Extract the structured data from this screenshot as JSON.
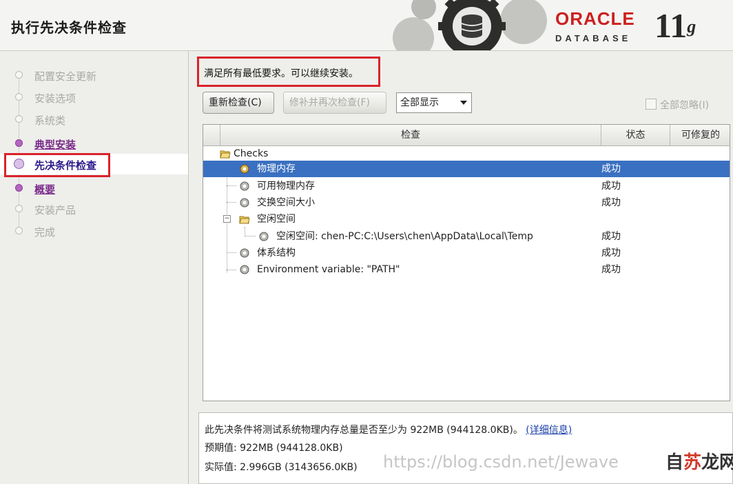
{
  "header": {
    "title": "执行先决条件检查",
    "brand_oracle": "ORACLE",
    "brand_database": "DATABASE",
    "brand_version": "11",
    "brand_version_sup": "g"
  },
  "sidebar": {
    "steps": [
      {
        "label": "配置安全更新",
        "state": "disabled"
      },
      {
        "label": "安装选项",
        "state": "disabled"
      },
      {
        "label": "系统类",
        "state": "disabled"
      },
      {
        "label": "典型安装",
        "state": "link"
      },
      {
        "label": "先决条件检查",
        "state": "active"
      },
      {
        "label": "概要",
        "state": "link"
      },
      {
        "label": "安装产品",
        "state": "disabled"
      },
      {
        "label": "完成",
        "state": "disabled"
      }
    ]
  },
  "main": {
    "message": "满足所有最低要求。可以继续安装。",
    "recheck_button": "重新检查(C)",
    "fix_button": "修补并再次检查(F)",
    "filter_select": "全部显示",
    "ignore_all_label": "全部忽略(I)",
    "table": {
      "columns": [
        "检查",
        "状态",
        "可修复的"
      ],
      "rows": [
        {
          "name": "Checks",
          "status": ""
        },
        {
          "name": "物理内存",
          "status": "成功"
        },
        {
          "name": "可用物理内存",
          "status": "成功"
        },
        {
          "name": "交换空间大小",
          "status": "成功"
        },
        {
          "name": "空闲空间",
          "status": ""
        },
        {
          "name": "空闲空间: chen-PC:C:\\Users\\chen\\AppData\\Local\\Temp",
          "status": "成功"
        },
        {
          "name": "体系结构",
          "status": "成功"
        },
        {
          "name": "Environment variable: \"PATH\"",
          "status": "成功"
        }
      ]
    },
    "details": {
      "description": "此先决条件将测试系统物理内存总量是否至少为 922MB (944128.0KB)。",
      "more_link": "(详细信息)",
      "expected_label": "预期值",
      "expected_value": ": 922MB (944128.0KB)",
      "actual_label": "实际值",
      "actual_value": ": 2.996GB (3143656.0KB)"
    }
  },
  "watermark": {
    "text": "https://blog.csdn.net/Jewave",
    "logo_a": "自",
    "logo_b": "苏",
    "logo_c": "龙网"
  },
  "colors": {
    "highlight_box": "#d9232a",
    "selection": "#3a70c1",
    "oracle_red": "#cc1f1f"
  }
}
